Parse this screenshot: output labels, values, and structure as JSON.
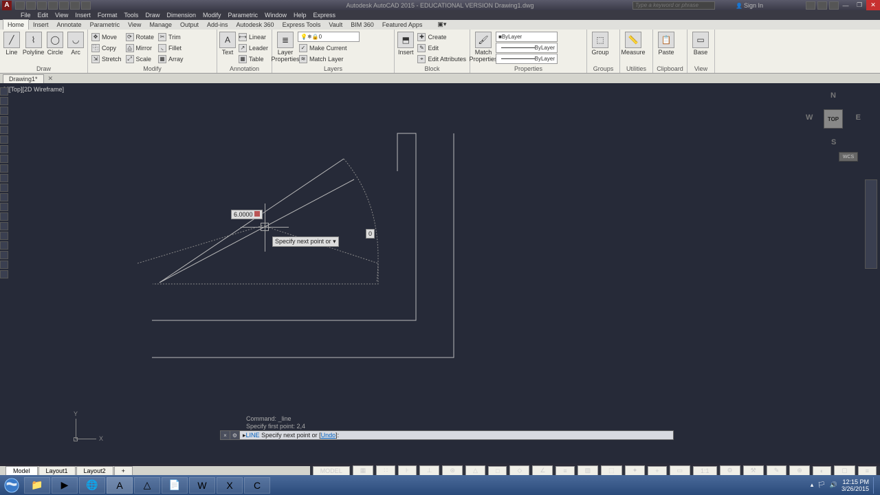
{
  "title": "Autodesk AutoCAD 2015 - EDUCATIONAL VERSION   Drawing1.dwg",
  "search_placeholder": "Type a keyword or phrase",
  "signin": "Sign In",
  "menus": [
    "File",
    "Edit",
    "View",
    "Insert",
    "Format",
    "Tools",
    "Draw",
    "Dimension",
    "Modify",
    "Parametric",
    "Window",
    "Help",
    "Express"
  ],
  "tabs": [
    "Home",
    "Insert",
    "Annotate",
    "Parametric",
    "View",
    "Manage",
    "Output",
    "Add-ins",
    "Autodesk 360",
    "Express Tools",
    "Vault",
    "BIM 360",
    "Featured Apps"
  ],
  "active_tab": "Home",
  "panels": {
    "draw": {
      "title": "Draw",
      "line": "Line",
      "polyline": "Polyline",
      "circle": "Circle",
      "arc": "Arc"
    },
    "modify": {
      "title": "Modify",
      "move": "Move",
      "rotate": "Rotate",
      "trim": "Trim",
      "copy": "Copy",
      "mirror": "Mirror",
      "fillet": "Fillet",
      "stretch": "Stretch",
      "scale": "Scale",
      "array": "Array"
    },
    "annotation": {
      "title": "Annotation",
      "text": "Text",
      "linear": "Linear",
      "leader": "Leader",
      "table": "Table"
    },
    "layers": {
      "title": "Layers",
      "props": "Layer\nProperties",
      "zero": "0",
      "bylayer": "ByLayer",
      "makecurrent": "Make Current",
      "matchlayer": "Match Layer"
    },
    "block": {
      "title": "Block",
      "insert": "Insert",
      "create": "Create",
      "edit": "Edit",
      "editattr": "Edit Attributes"
    },
    "properties": {
      "title": "Properties",
      "match": "Match\nProperties",
      "bylayer": "ByLayer"
    },
    "groups": {
      "title": "Groups",
      "group": "Group"
    },
    "utilities": {
      "title": "Utilities",
      "measure": "Measure"
    },
    "clipboard": {
      "title": "Clipboard",
      "paste": "Paste"
    },
    "view": {
      "title": "View",
      "base": "Base"
    }
  },
  "filetab": "Drawing1*",
  "viewlabel": "[-][Top][2D Wireframe]",
  "viewcube": {
    "top": "TOP",
    "n": "N",
    "s": "S",
    "e": "E",
    "w": "W"
  },
  "wcs": "WCS",
  "dynamic": {
    "distance": "6.0000",
    "prompt": "Specify next point or",
    "angle": "0"
  },
  "ucs": {
    "x": "X",
    "y": "Y"
  },
  "cmdhist": [
    "Command: _line",
    "Specify first point: 2,4"
  ],
  "cmdline": {
    "cmd": "LINE",
    "text": "Specify next point or [",
    "opt": "Undo",
    "tail": "]:"
  },
  "layouts": [
    "Model",
    "Layout1",
    "Layout2"
  ],
  "statusbar": {
    "model": "MODEL",
    "scale": "1:1"
  },
  "clock": {
    "time": "12:15 PM",
    "date": "3/26/2015"
  }
}
